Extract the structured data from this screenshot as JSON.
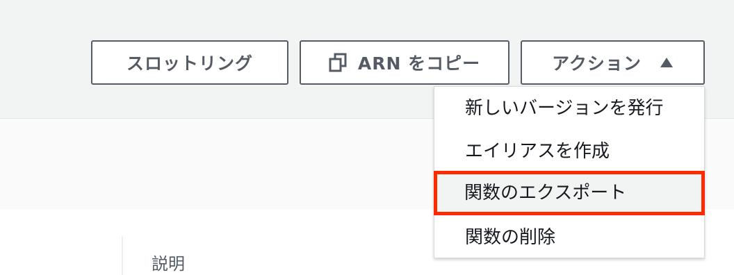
{
  "toolbar": {
    "throttle_label": "スロットリング",
    "copy_arn_label": "ARN をコピー",
    "actions_label": "アクション"
  },
  "actions_menu": {
    "items": [
      {
        "label": "新しいバージョンを発行"
      },
      {
        "label": "エイリアスを作成"
      },
      {
        "label": "関数のエクスポート"
      },
      {
        "label": "関数の削除"
      }
    ],
    "highlighted_index": 2,
    "highlight_color": "#ff2a00"
  },
  "details": {
    "description_label": "説明"
  },
  "icons": {
    "copy": "copy-icon",
    "actions_toggle": "caret-up-icon"
  }
}
